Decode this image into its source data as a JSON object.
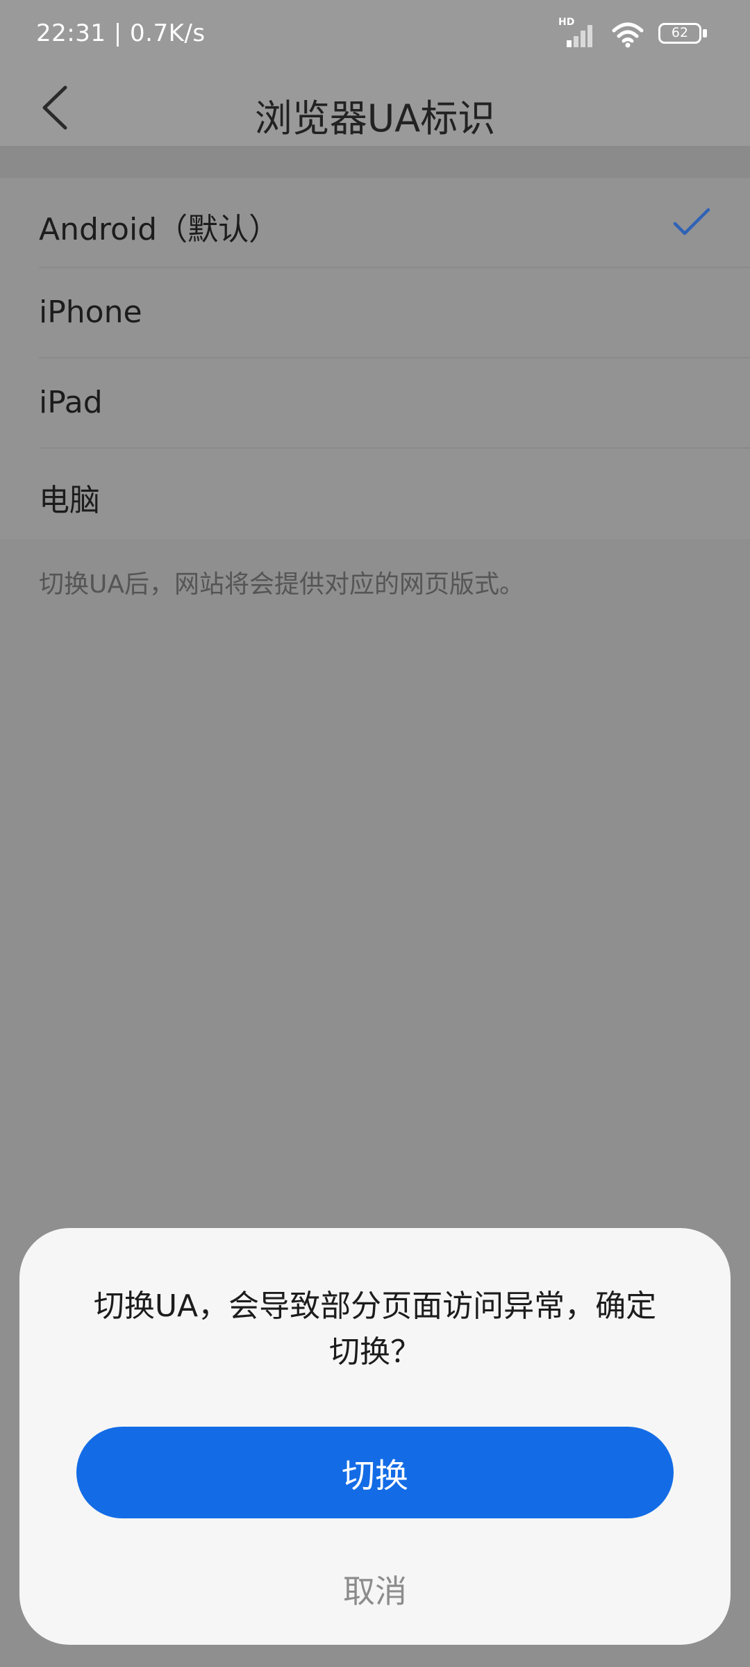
{
  "status_bar": {
    "time_speed": "22:31 | 0.7K/s",
    "signal_label": "HD",
    "battery_level": "62"
  },
  "toolbar": {
    "title": "浏览器UA标识"
  },
  "ua_options": [
    {
      "label": "Android（默认）",
      "selected": true
    },
    {
      "label": "iPhone",
      "selected": false
    },
    {
      "label": "iPad",
      "selected": false
    },
    {
      "label": "电脑",
      "selected": false
    }
  ],
  "hint": "切换UA后，网站将会提供对应的网页版式。",
  "dialog": {
    "message": "切换UA，会导致部分页面访问异常，确定切换？",
    "confirm_label": "切换",
    "cancel_label": "取消"
  },
  "colors": {
    "accent": "#136ce6",
    "check": "#2f63b6"
  }
}
